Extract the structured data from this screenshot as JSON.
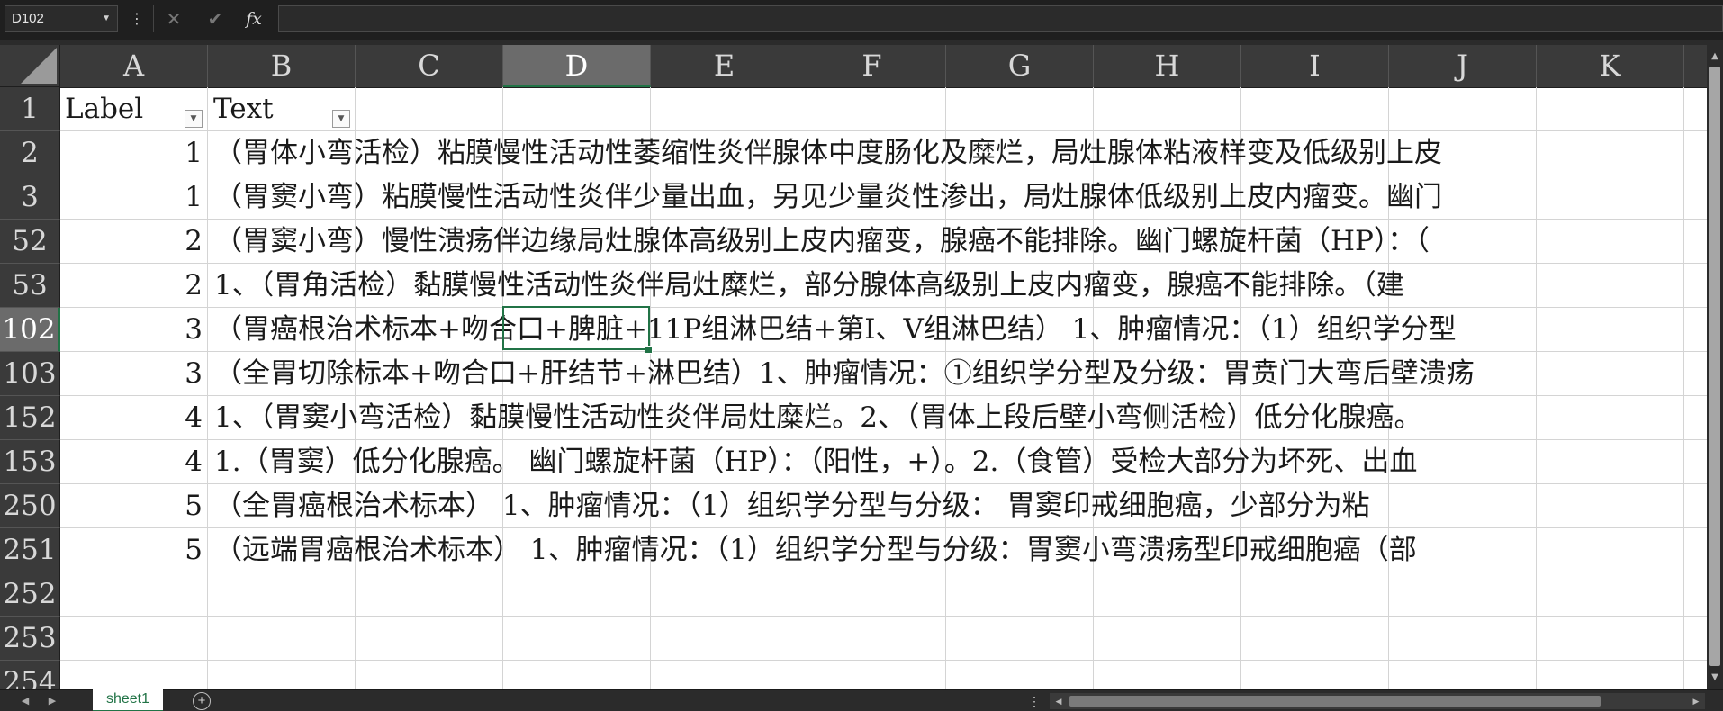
{
  "formula_bar": {
    "name_box": "D102",
    "cancel_icon": "✕",
    "enter_icon": "✔",
    "function_label": "fx",
    "formula_value": ""
  },
  "columns": [
    "A",
    "B",
    "C",
    "D",
    "E",
    "F",
    "G",
    "H",
    "I",
    "J",
    "K"
  ],
  "selected_column": "D",
  "selected_row": "102",
  "header_row": {
    "row": "1",
    "label_header": "Label",
    "text_header": "Text"
  },
  "rows": [
    {
      "row": "2",
      "label": "1",
      "text": "（胃体小弯活检）粘膜慢性活动性萎缩性炎伴腺体中度肠化及糜烂，局灶腺体粘液样变及低级别上皮"
    },
    {
      "row": "3",
      "label": "1",
      "text": "（胃窦小弯）粘膜慢性活动性炎伴少量出血，另见少量炎性渗出，局灶腺体低级别上皮内瘤变。幽门"
    },
    {
      "row": "52",
      "label": "2",
      "text": "（胃窦小弯）慢性溃疡伴边缘局灶腺体高级别上皮内瘤变，腺癌不能排除。幽门螺旋杆菌（HP）：（"
    },
    {
      "row": "53",
      "label": "2",
      "text": "1、（胃角活检）黏膜慢性活动性炎伴局灶糜烂，部分腺体高级别上皮内瘤变，腺癌不能排除。（建"
    },
    {
      "row": "102",
      "label": "3",
      "text": "（胃癌根治术标本+吻合口+脾脏+11P组淋巴结+第Ⅰ、Ⅴ组淋巴结） 1、肿瘤情况：（1）组织学分型"
    },
    {
      "row": "103",
      "label": "3",
      "text": "（全胃切除标本+吻合口+肝结节+淋巴结）1、肿瘤情况：①组织学分型及分级：胃贲门大弯后壁溃疡"
    },
    {
      "row": "152",
      "label": "4",
      "text": "1、（胃窦小弯活检）黏膜慢性活动性炎伴局灶糜烂。2、（胃体上段后壁小弯侧活检）低分化腺癌。"
    },
    {
      "row": "153",
      "label": "4",
      "text": "1.（胃窦）低分化腺癌。 幽门螺旋杆菌（HP）：（阳性，+）。2.（食管）受检大部分为坏死、出血"
    },
    {
      "row": "250",
      "label": "5",
      "text": "（全胃癌根治术标本） 1、肿瘤情况：（1）组织学分型与分级：    胃窦印戒细胞癌，少部分为粘"
    },
    {
      "row": "251",
      "label": "5",
      "text": "（远端胃癌根治术标本） 1、肿瘤情况：（1）组织学分型与分级：胃窦小弯溃疡型印戒细胞癌（部"
    },
    {
      "row": "252",
      "label": "",
      "text": ""
    },
    {
      "row": "253",
      "label": "",
      "text": ""
    },
    {
      "row": "254",
      "label": "",
      "text": ""
    }
  ],
  "sheet_tabs": [
    "sheet1"
  ],
  "add_sheet_icon": "+",
  "accent_color": "#217346"
}
